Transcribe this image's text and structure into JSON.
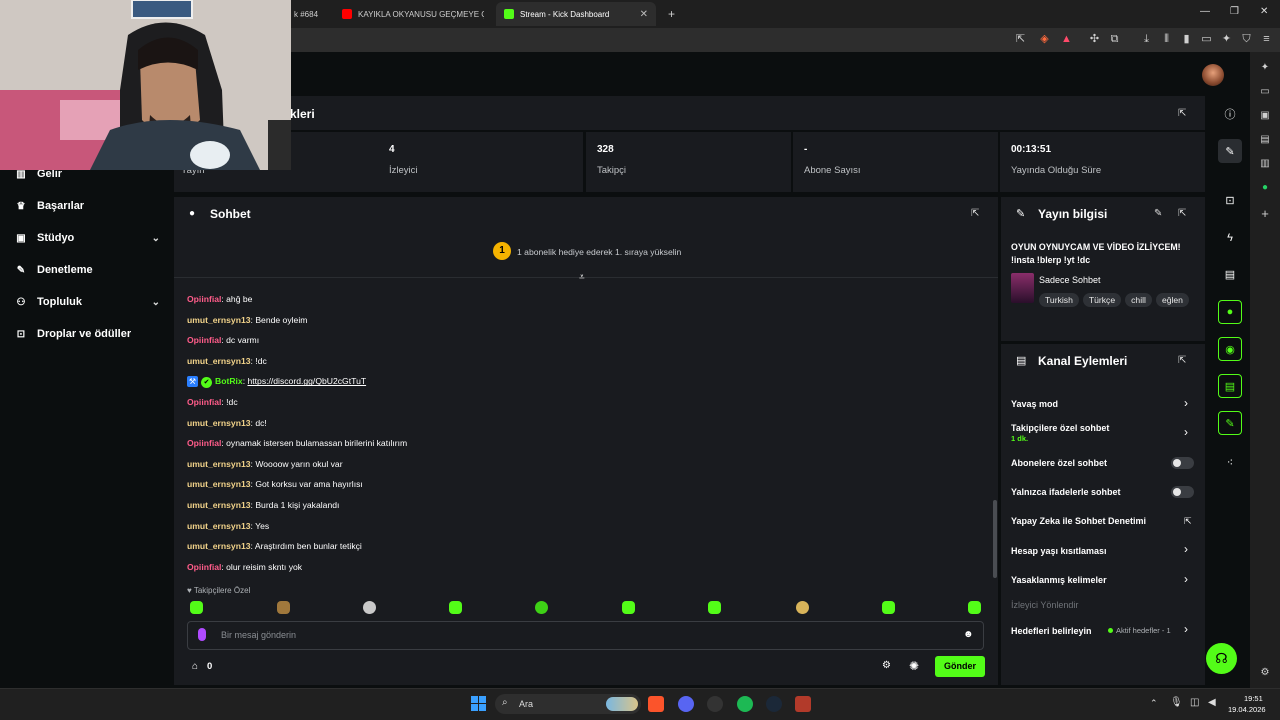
{
  "browser": {
    "tabs": [
      {
        "label": "k #684",
        "color": "#888888"
      },
      {
        "label": "KAYIKLA OKYANUSU GEÇMEYE ÇALIŞ",
        "color": "#ff0000"
      },
      {
        "label": "Stream - Kick Dashboard",
        "color": "#53fc18"
      }
    ],
    "new_tab": "+",
    "win_min": "—",
    "win_max": "❐",
    "win_close": "✕"
  },
  "sidebar": {
    "items": [
      {
        "label": "Gelir",
        "icon": "bar-chart-icon",
        "glyph": "▥"
      },
      {
        "label": "Başarılar",
        "icon": "trophy-icon",
        "glyph": "♛"
      },
      {
        "label": "Stüdyo",
        "icon": "studio-icon",
        "glyph": "▣",
        "chevron": "⌄"
      },
      {
        "label": "Denetleme",
        "icon": "wrench-icon",
        "glyph": "✎"
      },
      {
        "label": "Topluluk",
        "icon": "people-icon",
        "glyph": "⚇",
        "chevron": "⌄"
      },
      {
        "label": "Droplar ve ödüller",
        "icon": "drops-icon",
        "glyph": "⊡"
      }
    ]
  },
  "stats_header": {
    "title": "kleri"
  },
  "stats": [
    {
      "value": "",
      "label": "Yayın"
    },
    {
      "value": "4",
      "label": "İzleyici"
    },
    {
      "value": "328",
      "label": "Takipçi"
    },
    {
      "value": "-",
      "label": "Abone Sayısı"
    },
    {
      "value": "00:13:51",
      "label": "Yayında Olduğu Süre"
    }
  ],
  "chat": {
    "title": "Sohbet",
    "promo_badge": "1",
    "promo_text": "1 abonelik hediye ederek 1. sıraya yükselin",
    "messages": [
      {
        "user": "Opiinfial",
        "text": "ahğ be",
        "color": "#ff5c8a"
      },
      {
        "user": "umut_ernsyn13",
        "text": "Bende oyleim",
        "color": "#f2d38a"
      },
      {
        "user": "Opiinfial",
        "text": "dc varmı",
        "color": "#ff5c8a"
      },
      {
        "user": "umut_ernsyn13",
        "text": "!dc",
        "color": "#f2d38a"
      },
      {
        "user": "BotRix",
        "text": "https://discord.gg/QbU2cGtTuT",
        "color": "#53fc18",
        "bot": true
      },
      {
        "user": "Opiinfial",
        "text": "!dc",
        "color": "#ff5c8a"
      },
      {
        "user": "umut_ernsyn13",
        "text": "dc!",
        "color": "#f2d38a"
      },
      {
        "user": "Opiinfial",
        "text": "oynamak istersen bulamassan birilerini katılırım",
        "color": "#ff5c8a"
      },
      {
        "user": "umut_ernsyn13",
        "text": "Woooow yarın okul var",
        "color": "#f2d38a"
      },
      {
        "user": "umut_ernsyn13",
        "text": "Got korksu var ama hayırlısı",
        "color": "#f2d38a"
      },
      {
        "user": "umut_ernsyn13",
        "text": "Burda 1 kişi yakalandı",
        "color": "#f2d38a"
      },
      {
        "user": "umut_ernsyn13",
        "text": "Yes",
        "color": "#f2d38a"
      },
      {
        "user": "umut_ernsyn13",
        "text": "Araştırdım ben bunlar tetikçi",
        "color": "#f2d38a"
      },
      {
        "user": "Opiinfial",
        "text": "olur reisim skntı yok",
        "color": "#ff5c8a"
      }
    ],
    "followers_only_label": "Takipçilere Özel",
    "input_placeholder": "Bir mesaj gönderin",
    "points": "0",
    "send_label": "Gönder"
  },
  "stream_info": {
    "title": "Yayın bilgisi",
    "stream_title": "OYUN OYNUYCAM VE VİDEO İZLİYCEM! !insta !blerp !yt !dc",
    "category": "Sadece Sohbet",
    "tags": [
      "Turkish",
      "Türkçe",
      "chill",
      "eğlen"
    ]
  },
  "channel_actions": {
    "title": "Kanal Eylemleri",
    "slow_mode": "Yavaş mod",
    "followers_chat": "Takipçilere özel sohbet",
    "followers_chat_sub": "1 dk.",
    "subs_chat": "Abonelere özel sohbet",
    "emote_chat": "Yalnızca ifadelerle sohbet",
    "ai_moderation": "Yapay Zeka ile Sohbet Denetimi",
    "age_restriction": "Hesap yaşı kısıtlaması",
    "banned_words": "Yasaklanmış kelimeler",
    "viewer_section": "İzleyici Yönlendir",
    "goals": "Hedefleri belirleyin",
    "goals_status": "Aktif hedefler - 1"
  },
  "taskbar": {
    "search_label": "Ara",
    "time": "19:51",
    "date": "19.04.2026"
  },
  "colors": {
    "accent": "#53fc18",
    "panel": "#191b1f",
    "bg": "#0b0e0f"
  }
}
